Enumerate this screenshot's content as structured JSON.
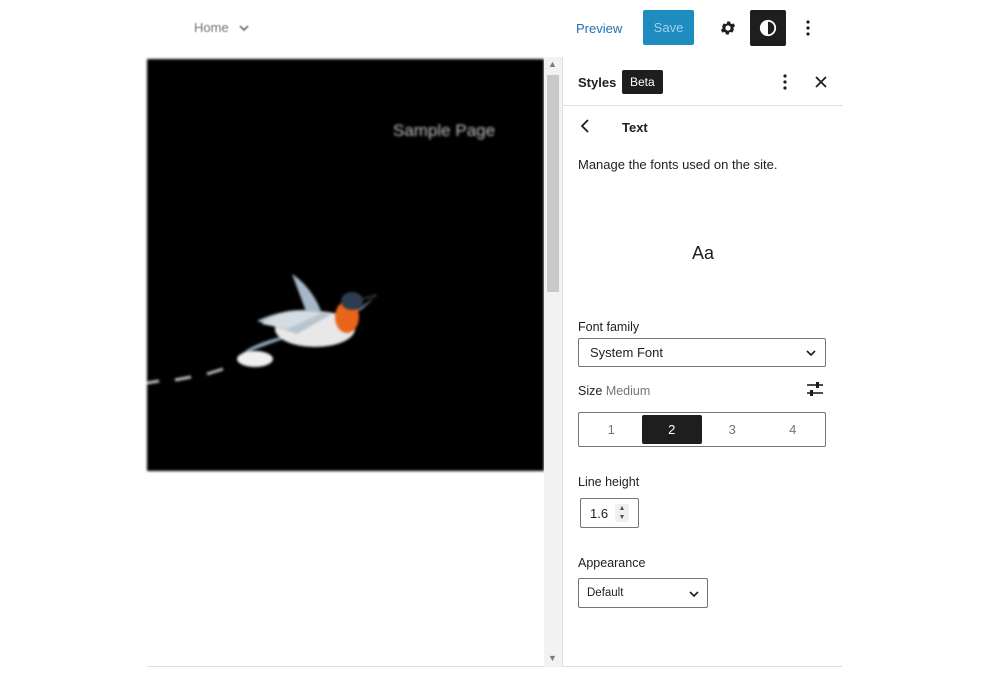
{
  "topbar": {
    "doc_title": "Home",
    "preview_label": "Preview",
    "save_label": "Save"
  },
  "canvas": {
    "page_link": "Sample Page"
  },
  "panel": {
    "title": "Styles",
    "badge": "Beta",
    "section_title": "Text",
    "description": "Manage the fonts used on the site.",
    "preview_text": "Aa",
    "font_family": {
      "label": "Font family",
      "value": "System Font"
    },
    "size": {
      "label": "Size",
      "value_label": "Medium",
      "options": [
        "1",
        "2",
        "3",
        "4"
      ],
      "selected": "2"
    },
    "line_height": {
      "label": "Line height",
      "value": "1.6"
    },
    "appearance": {
      "label": "Appearance",
      "value": "Default"
    }
  },
  "colors": {
    "accent": "#2271b1",
    "save_bg": "#1e8cbe",
    "dark": "#1e1e1e"
  }
}
